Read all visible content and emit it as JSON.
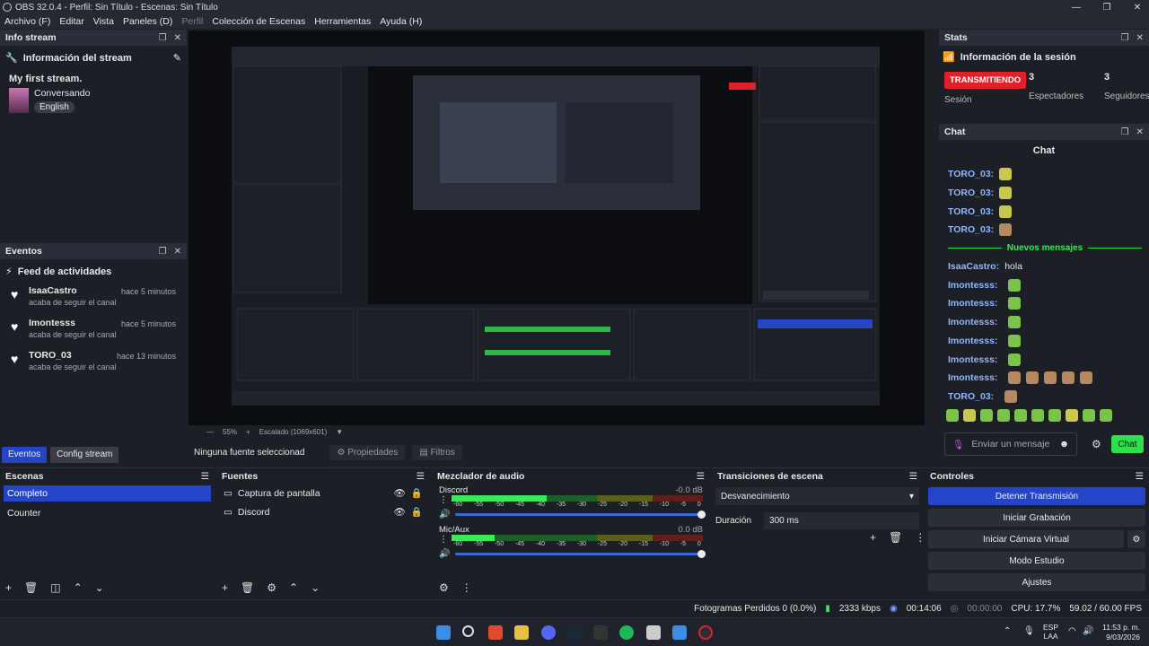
{
  "window": {
    "title": "OBS 32.0.4 - Perfil: Sin Título - Escenas: Sin Título",
    "min": "—",
    "max": "❐",
    "close": "✕"
  },
  "menu": [
    "Archivo (F)",
    "Editar",
    "Vista",
    "Paneles (D)",
    "Perfil",
    "Colección de Escenas",
    "Herramientas",
    "Ayuda (H)"
  ],
  "infostream": {
    "dock_title": "Info stream",
    "heading": "Información del stream",
    "stream_title": "My first stream.",
    "category": "Conversando",
    "language": "English"
  },
  "eventos": {
    "dock_title": "Eventos",
    "heading": "Feed de actividades",
    "items": [
      {
        "user": "IsaaCastro",
        "action": "acaba de seguir el canal",
        "time": "hace 5 minutos"
      },
      {
        "user": "Imontesss",
        "action": "acaba de seguir el canal",
        "time": "hace 5 minutos"
      },
      {
        "user": "TORO_03",
        "action": "acaba de seguir el canal",
        "time": "hace 13 minutos"
      }
    ]
  },
  "dock_tabs": [
    "Eventos",
    "Config stream"
  ],
  "preview": {
    "zoom": "55%",
    "scale": "Escalado (1069x601)"
  },
  "source_bar": {
    "no_source": "Ninguna fuente seleccionad",
    "properties": "Propiedades",
    "filters": "Filtros"
  },
  "stats": {
    "dock_title": "Stats",
    "heading": "Información de la sesión",
    "live_badge": "TRANSMITIENDO",
    "session": "Sesión",
    "viewers_count": "3",
    "viewers_label": "Espectadores",
    "followers_count": "3",
    "followers_label": "Seguidores"
  },
  "chat": {
    "dock_title": "Chat",
    "heading": "Chat",
    "lines": [
      {
        "user": "TORO_03:",
        "text": ""
      },
      {
        "user": "TORO_03:",
        "text": ""
      },
      {
        "user": "TORO_03:",
        "text": ""
      },
      {
        "user": "TORO_03:",
        "text": ""
      }
    ],
    "new_messages": "Nuevos mensajes",
    "new_lines": [
      {
        "user": "IsaaCastro:",
        "text": "hola"
      },
      {
        "user": "Imontesss:",
        "text": ""
      },
      {
        "user": "Imontesss:",
        "text": ""
      },
      {
        "user": "Imontesss:",
        "text": ""
      },
      {
        "user": "Imontesss:",
        "text": ""
      },
      {
        "user": "Imontesss:",
        "text": ""
      },
      {
        "user": "Imontesss:",
        "text": ""
      },
      {
        "user": "TORO_03:",
        "text": ""
      }
    ],
    "placeholder": "Enviar un mensaje",
    "send": "Chat"
  },
  "escenas": {
    "title": "Escenas",
    "items": [
      "Completo",
      "Counter"
    ]
  },
  "fuentes": {
    "title": "Fuentes",
    "items": [
      "Captura de pantalla",
      "Discord"
    ]
  },
  "mixer": {
    "title": "Mezclador de audio",
    "channels": [
      {
        "name": "Discord",
        "db": "-0.0 dB"
      },
      {
        "name": "Mic/Aux",
        "db": "0.0 dB"
      }
    ],
    "scale": [
      "-60",
      "-55",
      "-50",
      "-45",
      "-40",
      "-35",
      "-30",
      "-25",
      "-20",
      "-15",
      "-10",
      "-5",
      "0"
    ]
  },
  "transitions": {
    "title": "Transiciones de escena",
    "selected": "Desvanecimiento",
    "duration_label": "Duración",
    "duration": "300 ms"
  },
  "controls": {
    "title": "Controles",
    "buttons": [
      "Detener Transmisión",
      "Iniciar Grabación",
      "Iniciar Cámara Virtual",
      "Modo Estudio",
      "Ajustes"
    ]
  },
  "status": {
    "dropped": "Fotogramas Perdidos 0 (0.0%)",
    "kbps": "2333 kbps",
    "live_time": "00:14:06",
    "rec_time": "00:00:00",
    "cpu": "CPU: 17.7%",
    "fps": "59.02 / 60.00 FPS"
  },
  "taskbar": {
    "lang1": "ESP",
    "lang2": "LAA",
    "time": "11:53 p. m.",
    "date": "9/03/2026"
  },
  "colors": {
    "accent": "#2545c9",
    "live": "#e0202b",
    "chat_green": "#2ee04d"
  }
}
